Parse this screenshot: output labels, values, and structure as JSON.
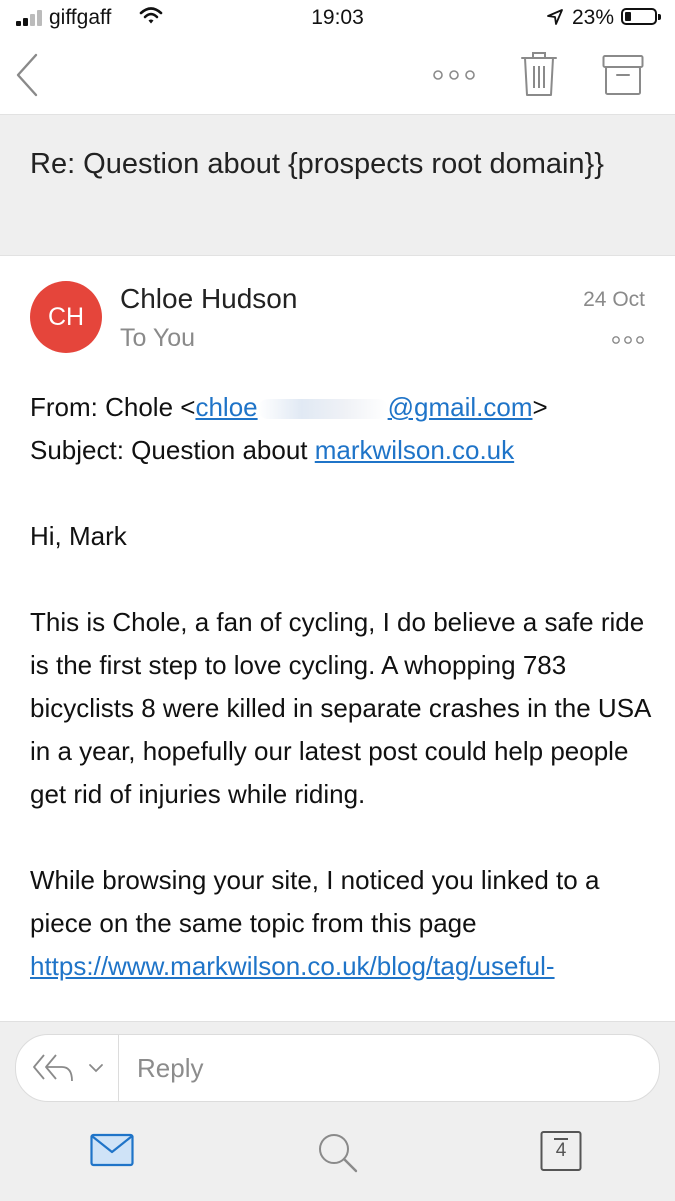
{
  "status_bar": {
    "carrier": "giffgaff",
    "time": "19:03",
    "battery_percent": "23%",
    "battery_level": 0.23
  },
  "toolbar": {
    "back_icon": "chevron-left-icon",
    "more_icon": "more-horizontal-icon",
    "delete_icon": "trash-icon",
    "archive_icon": "archive-icon"
  },
  "email": {
    "subject": "Re: Question about {prospects root domain}}",
    "sender": {
      "initials": "CH",
      "name": "Chloe Hudson",
      "recipient": "To You",
      "date": "24 Oct",
      "avatar_color": "#e5453b"
    },
    "body": {
      "from_label": "From: Chole <",
      "from_email_start": "chloe",
      "from_email_end": "@gmail.com",
      "from_close": ">",
      "subject_label": "Subject: Question about ",
      "subject_link": "markwilson.co.uk",
      "greeting": "Hi, Mark",
      "para1": "This is Chole, a fan of cycling, I do believe a safe ride is the first step to love cycling. A whopping 783 bicyclists 8 were killed in separate crashes in the USA in a year, hopefully our latest post could help people get rid of injuries while riding.",
      "para2": "While browsing your site, I noticed you linked to a piece on the same topic from this page",
      "link": "https://www.markwilson.co.uk/blog/tag/useful-"
    }
  },
  "reply_bar": {
    "placeholder": "Reply"
  },
  "tab_bar": {
    "mail_icon": "mail-icon",
    "search_icon": "search-icon",
    "calendar_icon": "calendar-icon",
    "calendar_day": "4"
  },
  "colors": {
    "link": "#1f74c8",
    "accent": "#1f74c8",
    "avatar": "#e5453b"
  }
}
